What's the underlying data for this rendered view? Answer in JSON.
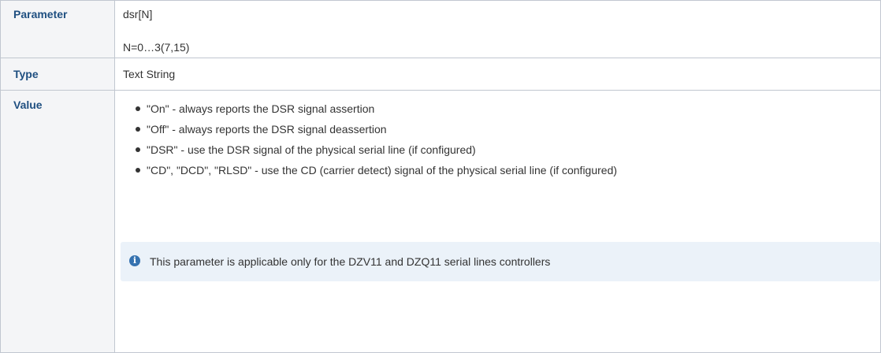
{
  "rows": {
    "parameter": {
      "label": "Parameter",
      "value": "dsr[N]",
      "range": "N=0…3(7,15)"
    },
    "type": {
      "label": "Type",
      "value": "Text String"
    },
    "value": {
      "label": "Value",
      "items": [
        "\"On\" - always reports the DSR signal assertion",
        "\"Off\" - always reports the DSR signal deassertion",
        "\"DSR\" - use the DSR signal of the physical serial line (if configured)",
        "\"CD\", \"DCD\", \"RLSD\" - use the CD (carrier detect) signal of the physical serial line (if configured)"
      ],
      "info_icon": "info-icon",
      "info_text": "This parameter is applicable only for the DZV11 and DZQ11 serial lines controllers"
    }
  },
  "colors": {
    "header_bg": "#f4f5f7",
    "header_text": "#205081",
    "border": "#c1c7d0",
    "info_bg": "#ebf2f9",
    "info_icon": "#3572b0"
  }
}
